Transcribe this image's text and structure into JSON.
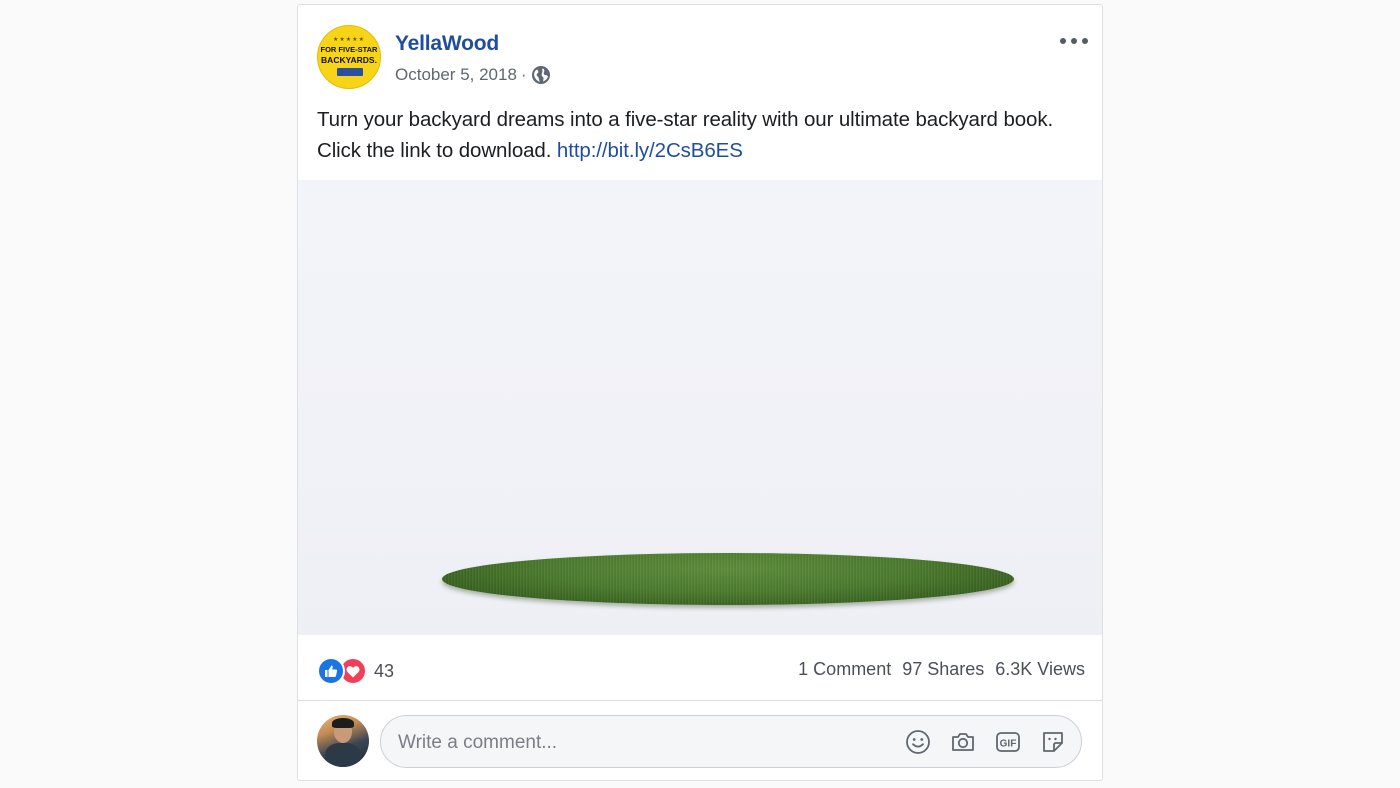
{
  "post": {
    "page_name": "YellaWood",
    "date": "October 5, 2018",
    "separator": "·",
    "privacy_icon": "globe-icon",
    "logo": {
      "line1": "FOR FIVE-STAR",
      "line2": "BACKYARDS.",
      "stars": "★★★★★"
    },
    "text": "Turn your backyard dreams into a five-star reality with our ultimate backyard book. Click the link to download.",
    "link": "http://bit.ly/2CsB6ES",
    "media": {
      "subject": "grass patch"
    }
  },
  "stats": {
    "reaction_icons": [
      "like-icon",
      "love-icon"
    ],
    "reaction_count": "43",
    "comments": "1 Comment",
    "shares": "97 Shares",
    "views": "6.3K Views"
  },
  "comment": {
    "placeholder": "Write a comment...",
    "icons": [
      "emoji-icon",
      "camera-icon",
      "gif-icon",
      "sticker-icon"
    ]
  },
  "colors": {
    "brand_blue": "#1f4e9e",
    "like_blue": "#1b74e4",
    "love_red": "#f33e58",
    "logo_yellow": "#f7d417"
  }
}
